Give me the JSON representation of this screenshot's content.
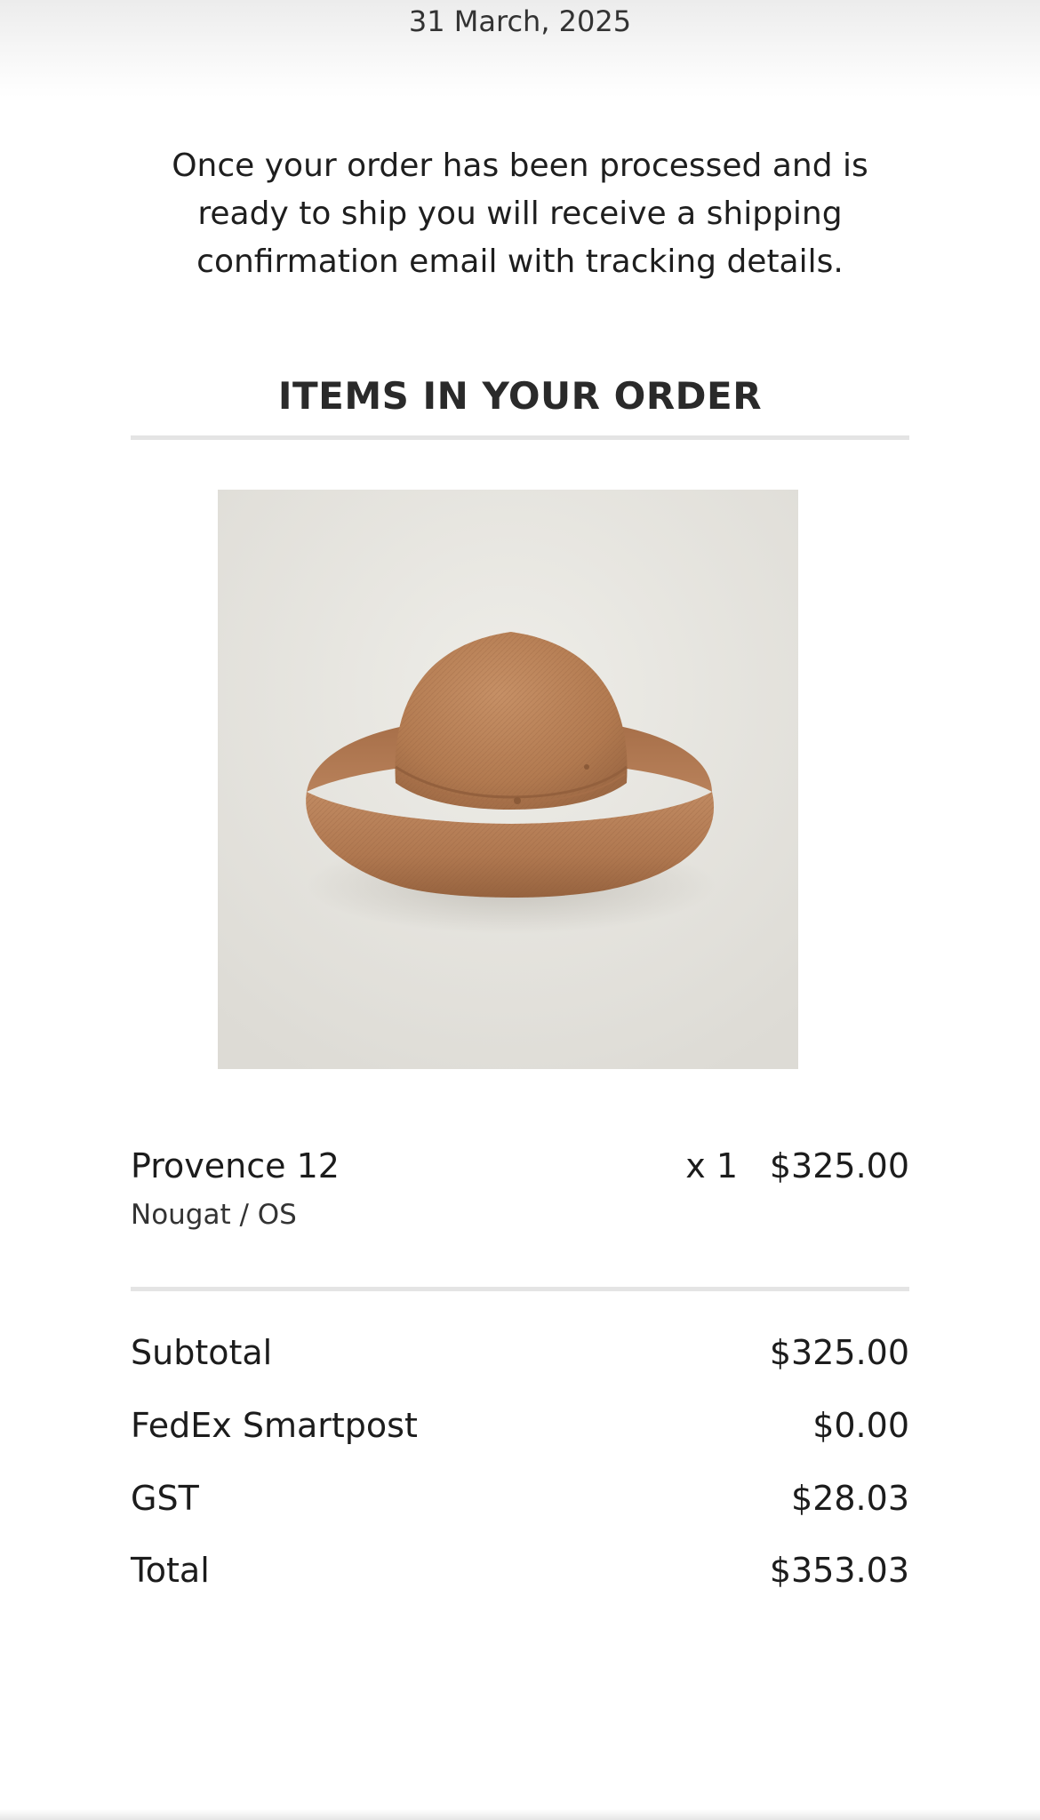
{
  "order": {
    "date": "31 March, 2025",
    "intro_message": "Once your order has been processed and is ready to ship you will receive a shipping confirmation email with tracking details."
  },
  "items_section": {
    "title": "ITEMS IN YOUR ORDER"
  },
  "items": [
    {
      "name": "Provence 12",
      "variant": "Nougat / OS",
      "quantity": "x 1",
      "price": "$325.00",
      "image_alt": "straw hat"
    }
  ],
  "summary": {
    "subtotal": {
      "label": "Subtotal",
      "value": "$325.00"
    },
    "shipping": {
      "label": "FedEx Smartpost",
      "value": "$0.00"
    },
    "tax": {
      "label": "GST",
      "value": "$28.03"
    },
    "total": {
      "label": "Total",
      "value": "$353.03"
    }
  },
  "colors": {
    "background": "#ffffff",
    "text": "#1c1c1c",
    "divider": "#e4e4e4",
    "hat": "#b87f55"
  }
}
